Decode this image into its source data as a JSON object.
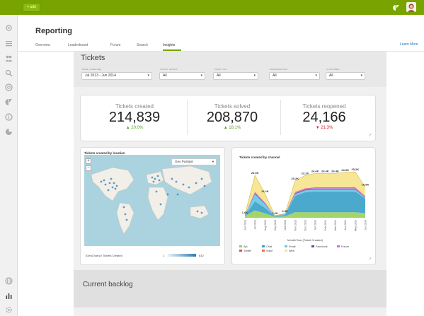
{
  "topbar": {
    "add_label": "+ add",
    "icons": [
      "zendesk-logo-icon",
      "user-avatar"
    ]
  },
  "sidebar": {
    "icons": [
      "gear-icon",
      "list-icon",
      "people-icon",
      "search-icon",
      "help-icon",
      "zendesk-icon",
      "info-icon",
      "zendesk-apps-icon",
      "globe-icon",
      "bar-chart-icon",
      "settings-icon"
    ]
  },
  "header": {
    "title": "Reporting",
    "tabs": [
      "Overview",
      "Leaderboard",
      "Forum",
      "Search",
      "Insights"
    ],
    "active_tab": "Insights",
    "learn_more": "Learn More"
  },
  "tickets": {
    "title": "Tickets",
    "filters": [
      {
        "label": "DATE (TIMELINE)",
        "value": "Jul 2013 - Jun 2014"
      },
      {
        "label": "TICKET GROUP",
        "value": "All"
      },
      {
        "label": "TICKET VIA",
        "value": "All"
      },
      {
        "label": "ORGANIZATION",
        "value": "All"
      },
      {
        "label": "CUSTOMER",
        "value": "All"
      }
    ],
    "stats": [
      {
        "label": "Tickets created",
        "value": "214,839",
        "delta": "▲ 20.0%",
        "direction": "up"
      },
      {
        "label": "Tickets solved",
        "value": "208,870",
        "delta": "▲ 18.1%",
        "direction": "up"
      },
      {
        "label": "Tickets reopened",
        "value": "24,166",
        "delta": "▼ 21.3%",
        "direction": "down"
      }
    ]
  },
  "geo": {
    "title": "Tickets created by location",
    "select_value": "Geo Pushpin",
    "legend_label": "[GeoChart] # Tickets Created",
    "legend_min": "1",
    "legend_max": "632",
    "zoom_in": "+",
    "zoom_out": "−"
  },
  "channel_chart": {
    "title": "Tickets created by channel",
    "xlabel": "Month/Year (Ticket Created)"
  },
  "chart_data": {
    "type": "area",
    "title": "Tickets created by channel",
    "xlabel": "Month/Year (Ticket Created)",
    "categories": [
      "Jun 2013",
      "Jul 2013",
      "Aug 2013",
      "Sep 2013",
      "Oct 2013",
      "Nov 2013",
      "Dec 2013",
      "Jan 2014",
      "Feb 2014",
      "Mar 2014",
      "Apr 2014",
      "May 2014",
      "Jun 2014"
    ],
    "totals_labels": [
      "1.6K",
      "23.3K",
      "13.2K",
      "1.2K",
      "2.3K",
      "20.2K",
      "23.2K",
      "24.4K",
      "24.4K",
      "24.4K",
      "24.9K",
      "25.2K",
      "16.9K"
    ],
    "totals": [
      1.6,
      23.3,
      13.2,
      1.2,
      2.3,
      20.2,
      23.2,
      24.4,
      24.4,
      24.4,
      24.9,
      25.2,
      16.9
    ],
    "series": [
      {
        "name": "Api",
        "color": "#9ad05a",
        "values": [
          1.0,
          4.0,
          2.5,
          0.5,
          0.8,
          3.0,
          3.0,
          3.0,
          3.0,
          3.0,
          3.0,
          3.0,
          2.5
        ]
      },
      {
        "name": "Chat",
        "color": "#39a0c9",
        "values": [
          0.3,
          5.0,
          3.0,
          0.3,
          0.7,
          9.0,
          11.0,
          11.5,
          11.5,
          11.5,
          11.5,
          11.5,
          8.0
        ]
      },
      {
        "name": "Email",
        "color": "#67c6e6",
        "values": [
          0.2,
          4.0,
          2.0,
          0.2,
          0.5,
          1.0,
          1.0,
          1.0,
          1.0,
          1.0,
          1.0,
          1.0,
          0.5
        ]
      },
      {
        "name": "Facebook",
        "color": "#7b3f9d",
        "values": [
          0.05,
          0.6,
          0.4,
          0.05,
          0.1,
          0.5,
          0.5,
          0.5,
          0.5,
          0.5,
          0.5,
          0.5,
          0.3
        ]
      },
      {
        "name": "Forum",
        "color": "#c27bd1",
        "values": [
          0.05,
          0.5,
          0.3,
          0.05,
          0.1,
          0.4,
          0.4,
          0.4,
          0.4,
          0.4,
          0.4,
          0.4,
          0.3
        ]
      },
      {
        "name": "Twitter",
        "color": "#e04a75",
        "values": [
          0.0,
          0.2,
          0.2,
          0.0,
          0.0,
          0.3,
          0.3,
          0.3,
          0.3,
          0.3,
          0.3,
          0.3,
          0.3
        ]
      },
      {
        "name": "Voice",
        "color": "#f06b5c",
        "values": [
          0.0,
          0.0,
          0.0,
          0.0,
          0.0,
          0.0,
          0.0,
          0.0,
          0.0,
          0.0,
          0.0,
          0.0,
          0.0
        ]
      },
      {
        "name": "Web",
        "color": "#f6e38a",
        "values": [
          0.0,
          9.0,
          4.8,
          0.1,
          0.1,
          6.0,
          7.0,
          7.7,
          7.7,
          7.7,
          8.2,
          8.5,
          5.0
        ]
      }
    ]
  },
  "backlog": {
    "title": "Current backlog"
  }
}
